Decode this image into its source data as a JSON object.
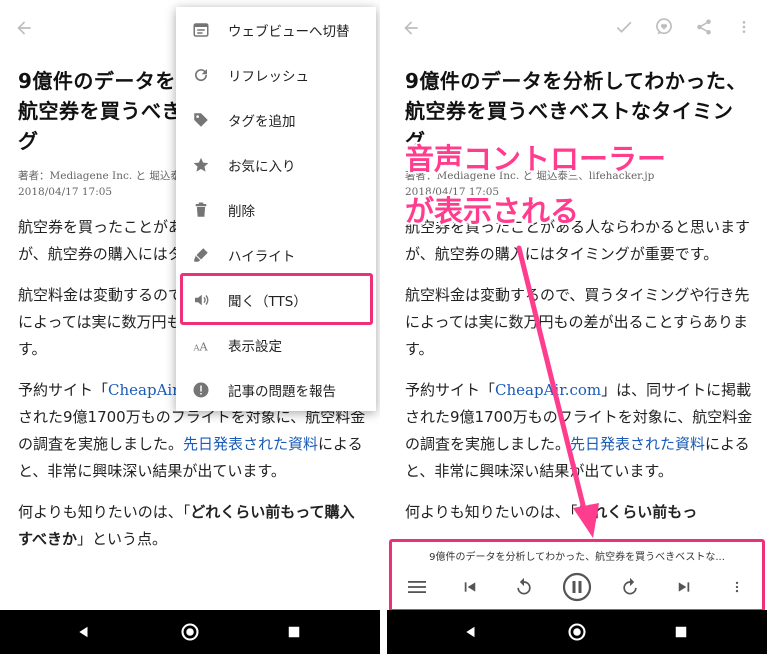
{
  "left_screen": {
    "article": {
      "title": "9億件のデータを分析してわかった、航空券を買うべきベストなタイミング",
      "meta_author": "著者：Mediagene Inc. と 堀込泰三、lifehacker.jp",
      "meta_date": "2018/04/17 17:05",
      "p1": "航空券を買ったことがある人ならわかると思いますが、航空券の購入にはタイミングが重要です。",
      "p2": "航空料金は変動するので、買うタイミングや行き先によっては実に数万円もの差が出ることすらあります。",
      "p3_pre": "予約サイト「",
      "p3_link": "CheapAir.com",
      "p3_mid": "」は、同サイトに掲載された9億1700万ものフライトを対象に、航空料金の調査を実施しました。",
      "p3_link2": "先日発表された資料",
      "p3_post": "によると、非常に興味深い結果が出ています。",
      "p4_pre": "何よりも知りたいのは、「",
      "p4_strong": "どれくらい前もって購入すべきか",
      "p4_post": "」という点。"
    },
    "menu": {
      "items": [
        {
          "label": "ウェブビューへ切替",
          "icon": "webview-icon"
        },
        {
          "label": "リフレッシュ",
          "icon": "refresh-icon"
        },
        {
          "label": "タグを追加",
          "icon": "tag-icon"
        },
        {
          "label": "お気に入り",
          "icon": "star-icon"
        },
        {
          "label": "削除",
          "icon": "trash-icon"
        },
        {
          "label": "ハイライト",
          "icon": "highlighter-icon"
        },
        {
          "label": "聞く（TTS）",
          "icon": "speaker-icon"
        },
        {
          "label": "表示設定",
          "icon": "text-size-icon"
        },
        {
          "label": "記事の問題を報告",
          "icon": "alert-icon"
        }
      ]
    }
  },
  "right_screen": {
    "article": {
      "title": "9億件のデータを分析してわかった、航空券を買うべきベストなタイミング",
      "meta_author": "著者：Mediagene Inc. と 堀込泰三、lifehacker.jp",
      "meta_date": "2018/04/17 17:05",
      "p1": "航空券を買ったことがある人ならわかると思いますが、航空券の購入にはタイミングが重要です。",
      "p2": "航空料金は変動するので、買うタイミングや行き先によっては実に数万円もの差が出ることすらあります。",
      "p3_pre": "予約サイト「",
      "p3_link": "CheapAir.com",
      "p3_mid": "」は、同サイトに掲載された9億1700万ものフライトを対象に、航空料金の調査を実施しました。",
      "p3_link2": "先日発表された資料",
      "p3_post": "によると、非常に興味深い結果が出ています。",
      "p4_pre": "何よりも知りたいのは、「",
      "p4_strong": "どれくらい前もっ"
    },
    "annotation": {
      "line1": "音声コントローラー",
      "line2": "が表示される"
    },
    "player": {
      "title": "9億件のデータを分析してわかった、航空券を買うべきベストな..."
    }
  },
  "colors": {
    "accent_pink": "#ee2f7a",
    "annotation_pink": "#ff3c8e",
    "link_blue": "#1a5bb8",
    "icon_gray": "#757575",
    "navbar": "#000000"
  }
}
